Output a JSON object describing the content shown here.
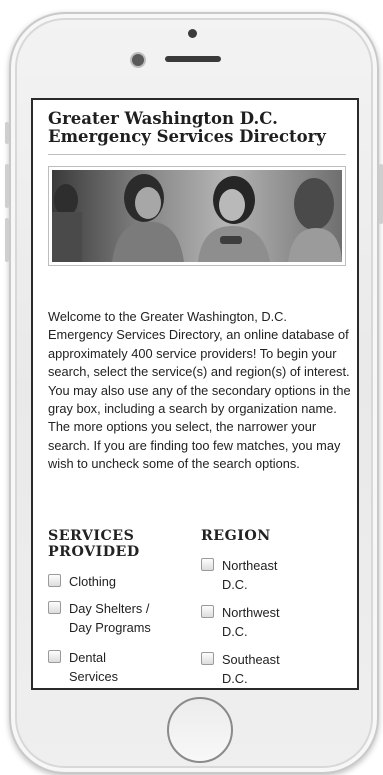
{
  "page": {
    "title": "Greater Washington D.C. Emergency Services Directory",
    "intro": "Welcome to the Greater Washington, D.C. Emergency Services Directory, an online database of approximately 400 service providers! To begin your search, select the service(s) and region(s) of interest. You may also use any of the secondary options in the gray box, including a search by organization name. The more options you select, the narrower your search. If you are finding too few matches, you may wish to uncheck some of the search options."
  },
  "services": {
    "heading_line1": "SERVICES",
    "heading_line2": "PROVIDED",
    "options": [
      {
        "line1": "Clothing",
        "line2": ""
      },
      {
        "line1": "Day Shelters /",
        "line2": "Day Programs"
      },
      {
        "line1": "Dental",
        "line2": "Services"
      }
    ]
  },
  "region": {
    "heading": "REGION",
    "options": [
      {
        "line1": "Northeast",
        "line2": "D.C."
      },
      {
        "line1": "Northwest",
        "line2": "D.C."
      },
      {
        "line1": "Southeast",
        "line2": "D.C."
      }
    ]
  },
  "colors": {
    "text": "#222222",
    "screen_border": "#2a2a2a",
    "checkbox_border": "#9a9a9a"
  },
  "icons": [
    "checkbox-icon",
    "camera-icon",
    "speaker-icon",
    "home-button-icon"
  ]
}
